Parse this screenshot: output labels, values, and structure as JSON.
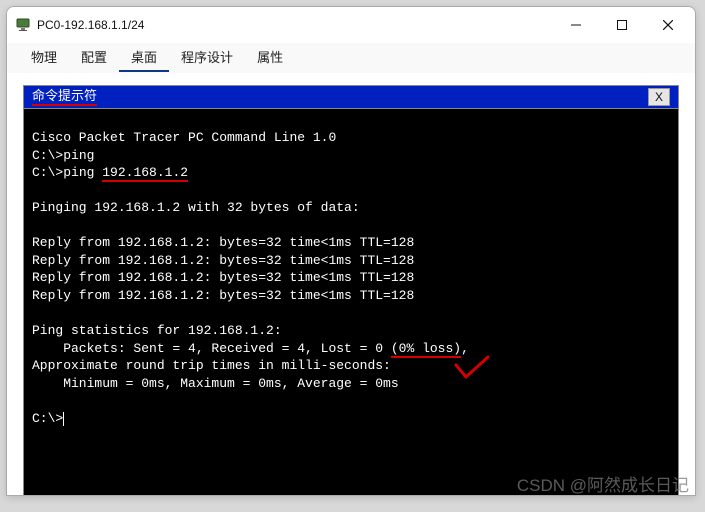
{
  "window": {
    "title": "PC0-192.168.1.1/24"
  },
  "tabs": {
    "items": [
      {
        "label": "物理"
      },
      {
        "label": "配置"
      },
      {
        "label": "桌面"
      },
      {
        "label": "程序设计"
      },
      {
        "label": "属性"
      }
    ],
    "active_index": 2
  },
  "cmd_window": {
    "title": "命令提示符",
    "close_label": "X"
  },
  "terminal": {
    "line_banner": "Cisco Packet Tracer PC Command Line 1.0",
    "prompt1": "C:\\>",
    "cmd1": "ping",
    "prompt2": "C:\\>",
    "cmd2_pre": "ping ",
    "cmd2_target": "192.168.1.2",
    "blank": "",
    "pinging": "Pinging 192.168.1.2 with 32 bytes of data:",
    "reply1": "Reply from 192.168.1.2: bytes=32 time<1ms TTL=128",
    "reply2": "Reply from 192.168.1.2: bytes=32 time<1ms TTL=128",
    "reply3": "Reply from 192.168.1.2: bytes=32 time<1ms TTL=128",
    "reply4": "Reply from 192.168.1.2: bytes=32 time<1ms TTL=128",
    "stats_hdr": "Ping statistics for 192.168.1.2:",
    "stats_pkts_pre": "    Packets: Sent = 4, Received = 4, Lost = 0 ",
    "stats_pkts_loss": "(0% loss)",
    "stats_pkts_post": ",",
    "rtt_hdr": "Approximate round trip times in milli-seconds:",
    "rtt_vals": "    Minimum = 0ms, Maximum = 0ms, Average = 0ms",
    "prompt3": "C:\\>"
  },
  "watermark": "CSDN @阿然成长日记"
}
